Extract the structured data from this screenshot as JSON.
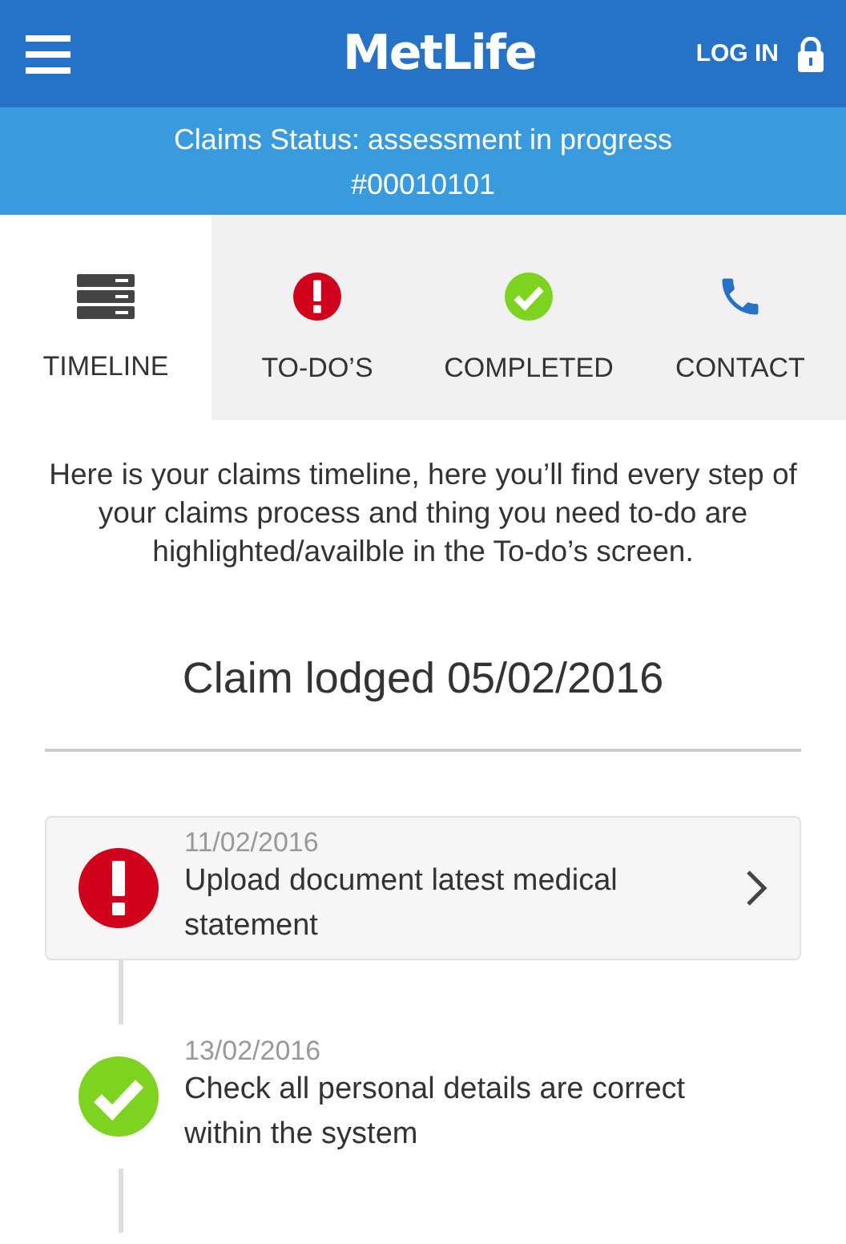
{
  "header": {
    "logo": "MetLife",
    "login": "LOG IN"
  },
  "status": {
    "title": "Claims Status: assessment in progress",
    "number": "#00010101"
  },
  "tabs": [
    {
      "label": "TIMELINE",
      "kind": "timeline",
      "selected": true
    },
    {
      "label": "TO-DO’S",
      "kind": "todo",
      "selected": false
    },
    {
      "label": "COMPLETED",
      "kind": "completed",
      "selected": false
    },
    {
      "label": "CONTACT",
      "kind": "contact",
      "selected": false
    }
  ],
  "intro": "Here is your claims timeline, here you’ll find every step of your claims process and thing you need to-do are highlighted/availble in the To-do’s screen.",
  "heading": "Claim lodged 05/02/2016",
  "timeline": [
    {
      "kind": "todo",
      "date": "11/02/2016",
      "text": "Upload document latest medical statement"
    },
    {
      "kind": "done",
      "date": "13/02/2016",
      "text": "Check all personal details are correct within the system"
    }
  ]
}
